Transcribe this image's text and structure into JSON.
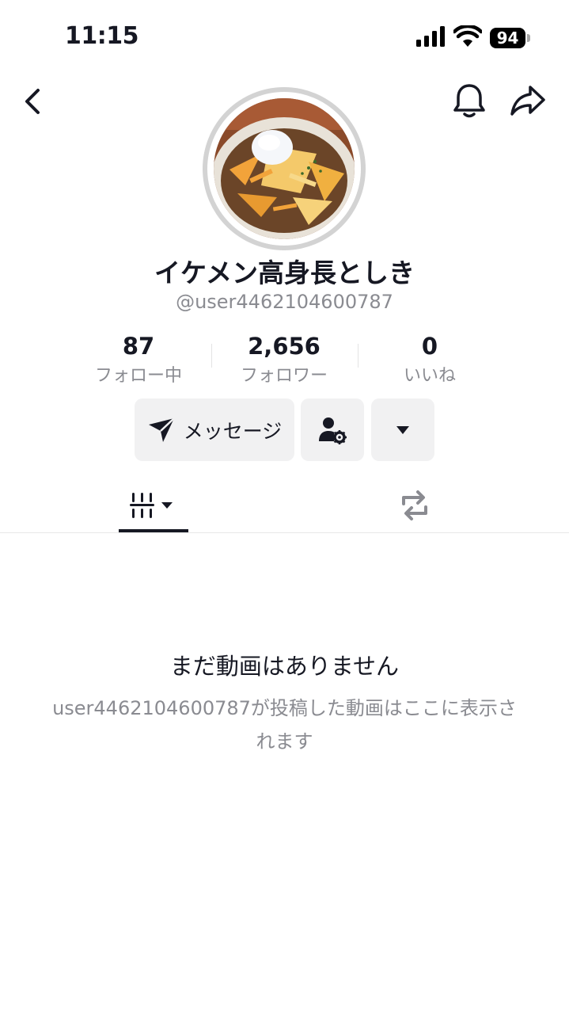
{
  "status_bar": {
    "time": "11:15",
    "battery": "94"
  },
  "profile": {
    "display_name": "イケメン高身長としき",
    "username": "@user4462104600787"
  },
  "stats": [
    {
      "value": "87",
      "label": "フォロー中"
    },
    {
      "value": "2,656",
      "label": "フォロワー"
    },
    {
      "value": "0",
      "label": "いいね"
    }
  ],
  "actions": {
    "message_label": "メッセージ"
  },
  "empty_state": {
    "title": "まだ動画はありません",
    "description": "user4462104600787が投稿した動画はここに表示されます"
  },
  "icons": {
    "back": "chevron-left-icon",
    "bell": "bell-icon",
    "share": "share-icon",
    "send": "send-icon",
    "follow_settings": "person-gear-icon",
    "more": "caret-down-icon",
    "videos_tab": "grid-bars-icon",
    "reposts_tab": "repost-icon"
  }
}
